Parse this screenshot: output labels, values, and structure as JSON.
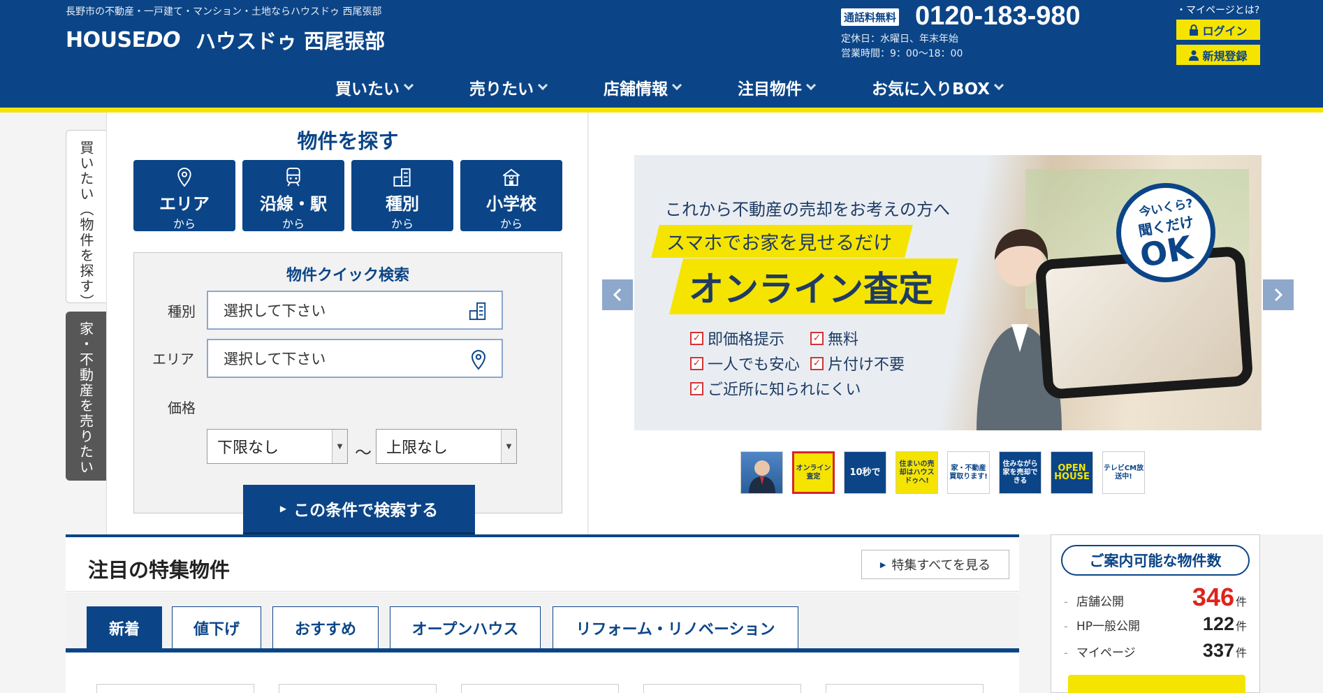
{
  "header": {
    "tagline": "長野市の不動産・一戸建て・マンション・土地ならハウスドゥ 西尾張部",
    "logo_en_main": "HOUSE",
    "logo_en_accent": "DO",
    "shop_name": "ハウスドゥ 西尾張部",
    "tel_badge": "通話料無料",
    "tel": "0120-183-980",
    "closed": "定休日：水曜日、年末年始",
    "hours": "営業時間：9：00〜18：00",
    "mypage_q": "・マイページとは?",
    "login": "ログイン",
    "register": "新規登録"
  },
  "nav": [
    {
      "label": "買いたい"
    },
    {
      "label": "売りたい"
    },
    {
      "label": "店舗情報"
    },
    {
      "label": "注目物件"
    },
    {
      "label": "お気に入りBOX"
    }
  ],
  "side_tabs": {
    "buy": "買いたい（物件を探す）",
    "sell": "家・不動産を売りたい"
  },
  "search": {
    "title": "物件を探す",
    "categories": [
      {
        "main": "エリア",
        "sub": "から",
        "icon": "map-pin-icon"
      },
      {
        "main": "沿線・駅",
        "sub": "から",
        "icon": "train-icon"
      },
      {
        "main": "種別",
        "sub": "から",
        "icon": "building-icon"
      },
      {
        "main": "小学校",
        "sub": "から",
        "icon": "school-icon"
      }
    ],
    "quick": {
      "title": "物件クイック検索",
      "type_label": "種別",
      "type_value": "選択して下さい",
      "area_label": "エリア",
      "area_value": "選択して下さい",
      "price_label": "価格",
      "price_min": "下限なし",
      "price_sep": "〜",
      "price_max": "上限なし",
      "submit": "この条件で検索する"
    }
  },
  "banner": {
    "line1": "これから不動産の売却をお考えの方へ",
    "line2": "スマホでお家を見せるだけ",
    "line3": "オンライン査定",
    "checks": [
      "即価格提示",
      "無料",
      "一人でも安心",
      "片付け不要",
      "ご近所に知られにくい"
    ],
    "circle1": "今いくら?",
    "circle2": "聞くだけ",
    "circle3": "OK"
  },
  "thumbs": [
    {
      "label": ""
    },
    {
      "label": "オンライン査定"
    },
    {
      "label": "10秒で"
    },
    {
      "label": "住まいの売却はハウスドゥへ!"
    },
    {
      "label": "家・不動産買取ります!"
    },
    {
      "label": "住みながら家を売却できる"
    },
    {
      "label": "OPEN HOUSE"
    },
    {
      "label": "テレビCM放送中!"
    }
  ],
  "featured": {
    "title": "注目の特集物件",
    "see_all": "特集すべてを見る",
    "tabs": [
      "新着",
      "値下げ",
      "おすすめ",
      "オープンハウス",
      "リフォーム・リノベーション"
    ],
    "active_tab": "新着"
  },
  "stats": {
    "title": "ご案内可能な物件数",
    "rows": [
      {
        "label": "店舗公開",
        "count": "346",
        "unit": "件"
      },
      {
        "label": "HP一般公開",
        "count": "122",
        "unit": "件"
      },
      {
        "label": "マイページ",
        "count": "337",
        "unit": "件"
      }
    ]
  },
  "colors": {
    "brand_blue": "#0b4587",
    "accent_yellow": "#f5e400",
    "count_red": "#e0231b"
  }
}
